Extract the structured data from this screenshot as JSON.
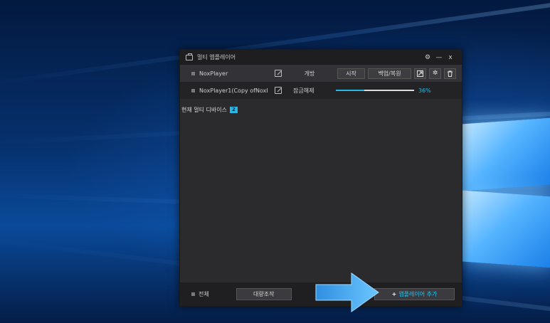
{
  "window": {
    "title": "멀티 앱플레이어",
    "controls": {
      "settings": "⚙",
      "minimize": "—",
      "close": "x"
    }
  },
  "instances": [
    {
      "name": "NoxPlayer",
      "status": "개방",
      "start_label": "시작",
      "backup_label": "백업/복원"
    },
    {
      "name": "NoxPlayer1(Copy ofNoxF",
      "status": "잠금해제",
      "progress": 36,
      "progress_text": "36%"
    }
  ],
  "device_count": {
    "label": "현재 멀티 디바이스",
    "count": "2"
  },
  "footer": {
    "select_all_label": "전체",
    "batch_label": "대량조작",
    "add_label": "앱플레이어 추가",
    "add_plus": "+"
  },
  "colors": {
    "accent": "#29b8e6",
    "window_bg": "#2b2b2e",
    "arrow": "#3fa9f5"
  }
}
